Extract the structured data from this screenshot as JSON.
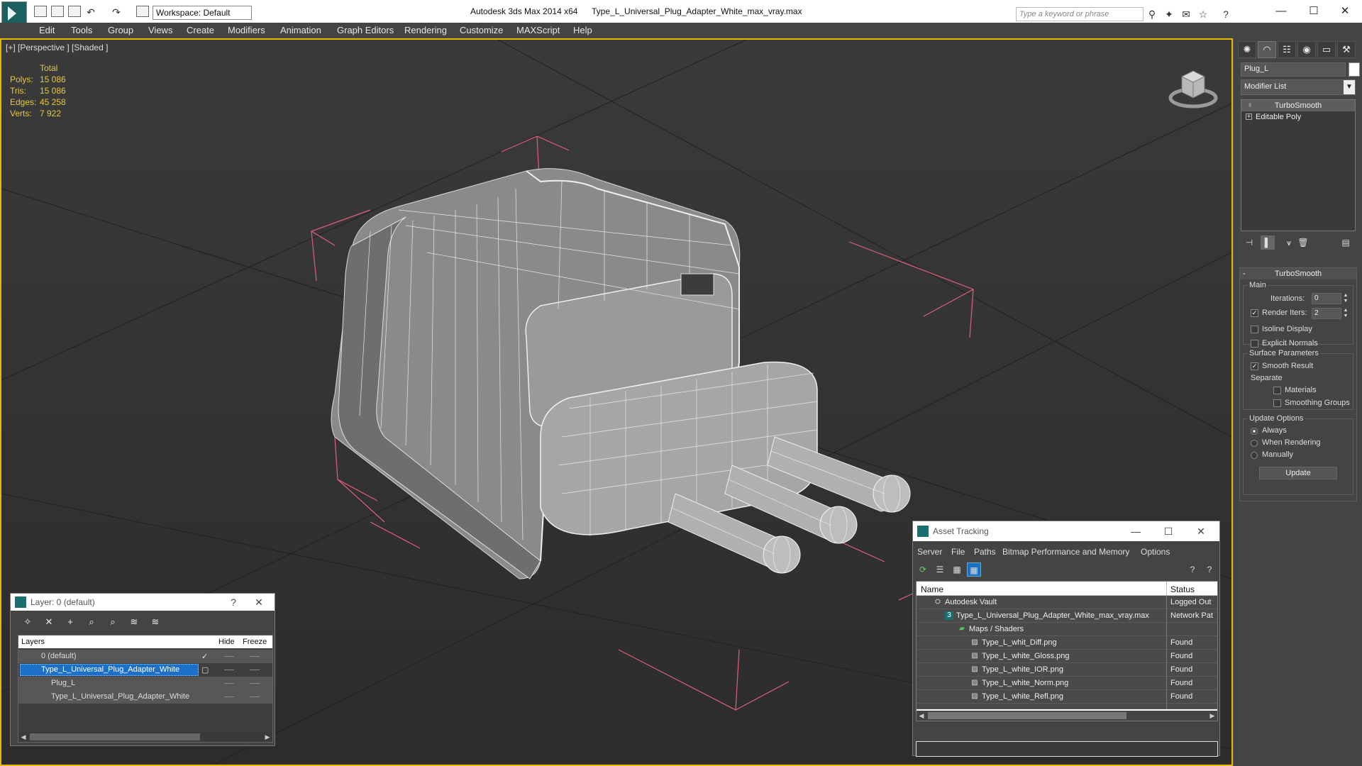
{
  "titlebar": {
    "workspace": "Workspace: Default",
    "app_title": "Autodesk 3ds Max  2014 x64",
    "file_title": "Type_L_Universal_Plug_Adapter_White_max_vray.max",
    "search_placeholder": "Type a keyword or phrase",
    "minimize": "—",
    "maximize": "☐",
    "close": "✕"
  },
  "menu": [
    "Edit",
    "Tools",
    "Group",
    "Views",
    "Create",
    "Modifiers",
    "Animation",
    "Graph Editors",
    "Rendering",
    "Customize",
    "MAXScript",
    "Help"
  ],
  "viewport": {
    "label": "[+] [Perspective ] [Shaded ]",
    "stats": {
      "header": "Total",
      "rows": [
        {
          "label": "Polys:",
          "value": "15 086"
        },
        {
          "label": "Tris:",
          "value": "15 086"
        },
        {
          "label": "Edges:",
          "value": "45 258"
        },
        {
          "label": "Verts:",
          "value": "7 922"
        }
      ]
    }
  },
  "command_panel": {
    "object_name": "Plug_L",
    "modifier_list": "Modifier List",
    "stack": [
      "TurboSmooth",
      "Editable Poly"
    ],
    "rollout": {
      "title": "TurboSmooth",
      "main_group": "Main",
      "iterations_label": "Iterations:",
      "iterations_value": "0",
      "render_iters_label": "Render Iters:",
      "render_iters_value": "2",
      "isoline": "Isoline Display",
      "explicit_normals": "Explicit Normals",
      "surface_group": "Surface Parameters",
      "smooth_result": "Smooth Result",
      "separate": "Separate",
      "materials": "Materials",
      "smoothing_groups": "Smoothing Groups",
      "update_group": "Update Options",
      "always": "Always",
      "when_rendering": "When Rendering",
      "manually": "Manually",
      "update_button": "Update"
    }
  },
  "layer_dialog": {
    "title": "Layer: 0 (default)",
    "help": "?",
    "close": "✕",
    "columns": {
      "layers": "Layers",
      "hide": "Hide",
      "freeze": "Freeze"
    },
    "rows": [
      {
        "name": "0 (default)"
      },
      {
        "name": "Type_L_Universal_Plug_Adapter_White"
      },
      {
        "name": "Plug_L"
      },
      {
        "name": "Type_L_Universal_Plug_Adapter_White"
      }
    ]
  },
  "asset_tracking": {
    "title": "Asset Tracking",
    "menu": [
      "Server",
      "File",
      "Paths",
      "Bitmap Performance and Memory",
      "Options"
    ],
    "columns": {
      "name": "Name",
      "status": "Status"
    },
    "rows": [
      {
        "name": "Autodesk Vault",
        "status": "Logged Out"
      },
      {
        "name": "Type_L_Universal_Plug_Adapter_White_max_vray.max",
        "status": "Network Pat"
      },
      {
        "name": "Maps / Shaders",
        "status": ""
      },
      {
        "name": "Type_L_whit_Diff.png",
        "status": "Found"
      },
      {
        "name": "Type_L_white_Gloss.png",
        "status": "Found"
      },
      {
        "name": "Type_L_white_IOR.png",
        "status": "Found"
      },
      {
        "name": "Type_L_white_Norm.png",
        "status": "Found"
      },
      {
        "name": "Type_L_white_Refl.png",
        "status": "Found"
      }
    ]
  },
  "colors": {
    "viewport_border": "#e6b800",
    "stats_text": "#e8c840",
    "selection_blue": "#1d70c8",
    "bounding_box": "#e0607a"
  }
}
